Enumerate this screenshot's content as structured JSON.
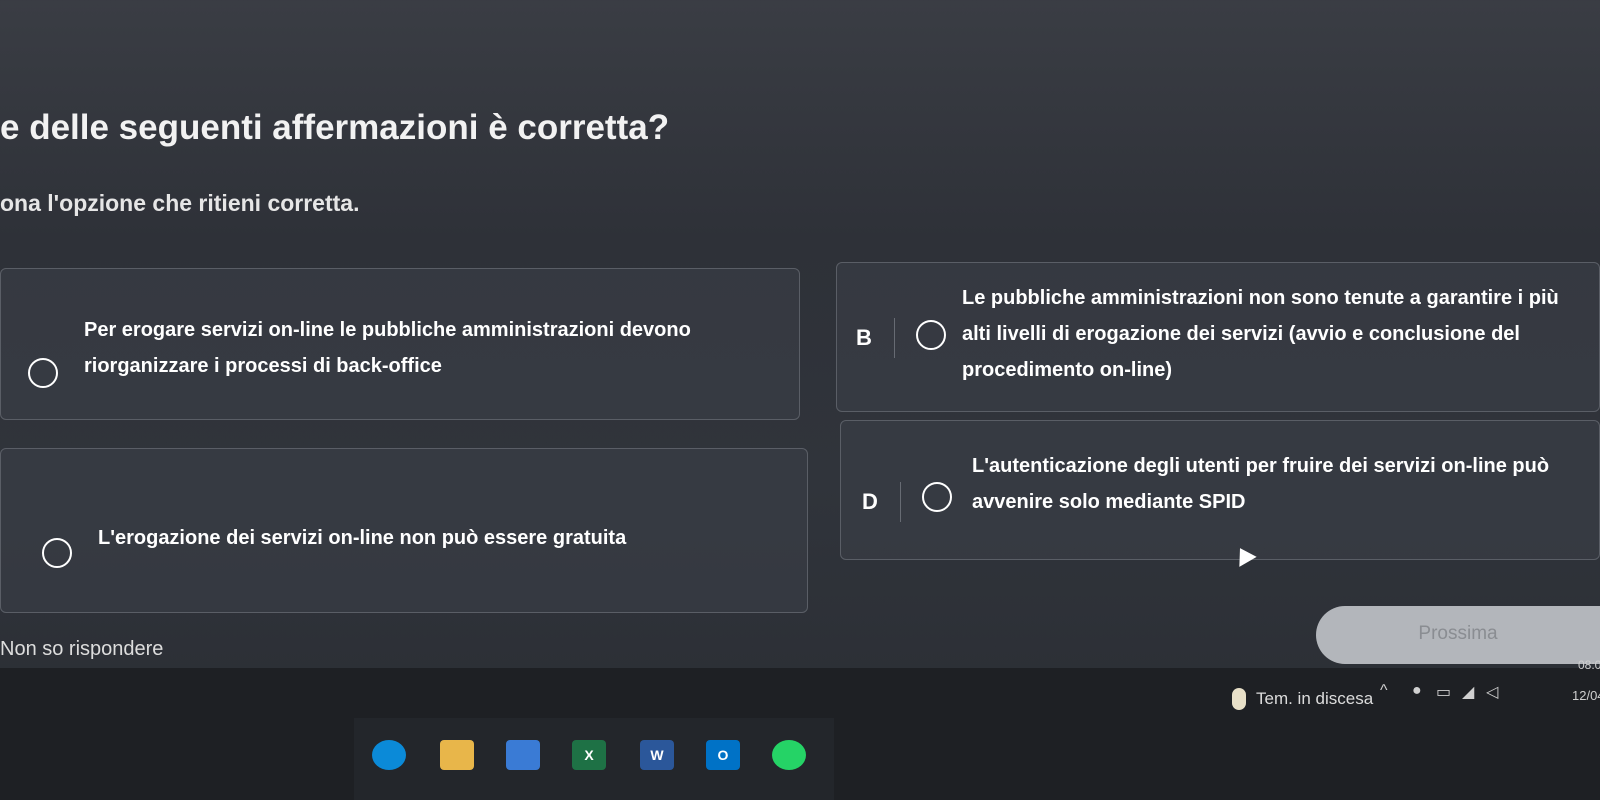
{
  "question": {
    "title": "e delle seguenti affermazioni è corretta?",
    "instruction": "ona l'opzione che ritieni corretta."
  },
  "options": [
    {
      "letter": "",
      "text": "Per erogare servizi on-line le pubbliche amministrazioni devono riorganizzare i processi di back-office"
    },
    {
      "letter": "B",
      "text": "Le pubbliche amministrazioni non sono tenute a garantire i più alti livelli di erogazione dei servizi (avvio e conclusione del procedimento on-line)"
    },
    {
      "letter": "",
      "text": "L'erogazione dei servizi on-line non può essere gratuita"
    },
    {
      "letter": "D",
      "text": "L'autenticazione degli utenti per fruire dei servizi on-line può avvenire solo mediante SPID"
    }
  ],
  "footer": {
    "skip_label": "Non so rispondere",
    "next_label": "Prossima"
  },
  "taskbar": {
    "weather": "Tem. in discesa",
    "time": "08:0",
    "date": "12/04/",
    "apps": [
      "edge-icon",
      "file-explorer-icon",
      "store-icon",
      "excel-icon",
      "word-icon",
      "outlook-icon",
      "whatsapp-icon"
    ]
  },
  "colors": {
    "background": "#30343b",
    "card_border": "#5a5e66",
    "next_button": "#b3b6bb",
    "excel": "#1e7145",
    "word": "#2b579a",
    "outlook": "#0072c6",
    "whatsapp": "#25d366",
    "edge": "#0b8ad8"
  }
}
